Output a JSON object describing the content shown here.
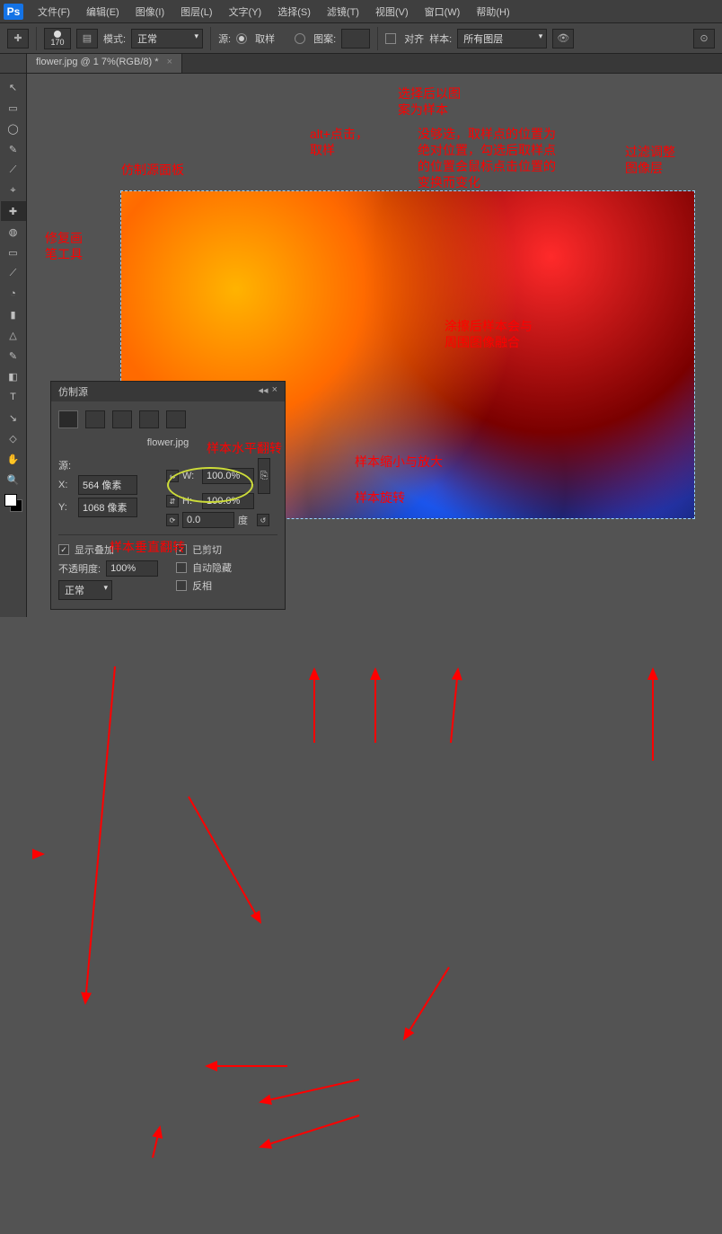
{
  "logo": "Ps",
  "menu": [
    "文件(F)",
    "编辑(E)",
    "图像(I)",
    "图层(L)",
    "文字(Y)",
    "选择(S)",
    "滤镜(T)",
    "视图(V)",
    "窗口(W)",
    "帮助(H)"
  ],
  "options": {
    "brush_size": "170",
    "mode_label": "模式:",
    "mode_value": "正常",
    "src_label": "源:",
    "sample_label": "取样",
    "pattern_label": "图案:",
    "align_label": "对齐",
    "sample2_label": "样本:",
    "sample2_value": "所有图层"
  },
  "doc_tab": "flower.jpg @ 1  7%(RGB/8) *",
  "tools": [
    "↖",
    "▭",
    "◯",
    "✎",
    "⟋",
    "⌖",
    "✚",
    "◍",
    "▭",
    "⟋",
    "◔",
    "▮",
    "△",
    "✎",
    "◧",
    "●",
    "T",
    "↘",
    "◇",
    "✋",
    "🔍"
  ],
  "panel": {
    "title": "仿制源",
    "filename": "flower.jpg",
    "src_label": "源:",
    "x_label": "X:",
    "x_value": "564 像素",
    "y_label": "Y:",
    "y_value": "1068 像素",
    "w_label": "W:",
    "w_value": "100.0%",
    "h_label": "H:",
    "h_value": "100.0%",
    "angle_value": "0.0",
    "angle_unit": "度",
    "show_overlay": "显示叠加",
    "clipped": "已剪切",
    "opacity_label": "不透明度:",
    "opacity_value": "100%",
    "auto_hide": "自动隐藏",
    "invert": "反相",
    "blend_value": "正常"
  },
  "anno": {
    "clone_panel": "仿制源面板",
    "heal_tool": "修复画\n笔工具",
    "alt": "alt+点击，\n取样",
    "pattern": "选择后以图\n案为样本",
    "align": "没够选，取样点的位置为\n绝对位置，勾选后取样点\n的位置会鼠标点击位置的\n变换而变化",
    "filter": "过滤调整\n图像层",
    "blend": "涂擦后样本会与\n周围图像融合",
    "hflip": "样本水平翻转",
    "vflip": "样本垂直翻转",
    "scale": "样本缩小与放大",
    "rotate": "样本旋转"
  }
}
